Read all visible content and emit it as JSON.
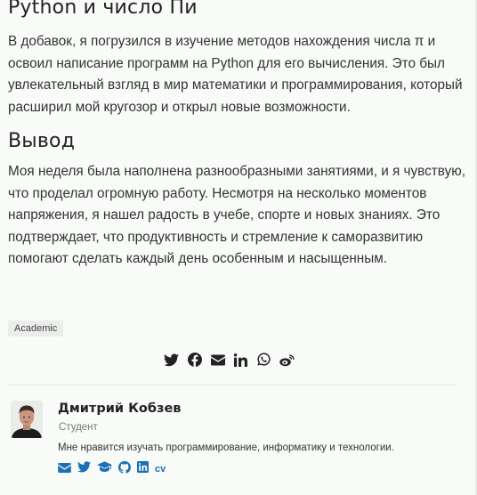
{
  "sections": [
    {
      "heading": "Python и число Пи",
      "text": "В добавок, я погрузился в изучение методов нахождения числа π и освоил написание программ на Python для его вычисления. Это был увлекательный взгляд в мир математики и программирования, который расширил мой кругозор и открыл новые возможности."
    },
    {
      "heading": "Вывод",
      "text": "Моя неделя была наполнена разнообразными занятиями, и я чувствую, что проделал огромную работу. Несмотря на несколько моментов напряжения, я нашел радость в учебе, спорте и новых знаниях. Это подтверждает, что продуктивность и стремление к саморазвитию помогают сделать каждый день особенным и насыщенным."
    }
  ],
  "tags": [
    "Academic"
  ],
  "share_icons": [
    "twitter-icon",
    "facebook-icon",
    "email-icon",
    "linkedin-icon",
    "whatsapp-icon",
    "weibo-icon"
  ],
  "author": {
    "name": "Дмитрий Кобзев",
    "role": "Студент",
    "bio": "Мне нравится изучать программирование, информатику и технологии.",
    "links": [
      "email-icon",
      "twitter-icon",
      "graduation-cap-icon",
      "github-icon",
      "linkedin-icon"
    ],
    "cv_label": "cv"
  },
  "colors": {
    "background": "#f8fbf8",
    "share_icon": "#222222",
    "author_link": "#1b6fb5"
  }
}
